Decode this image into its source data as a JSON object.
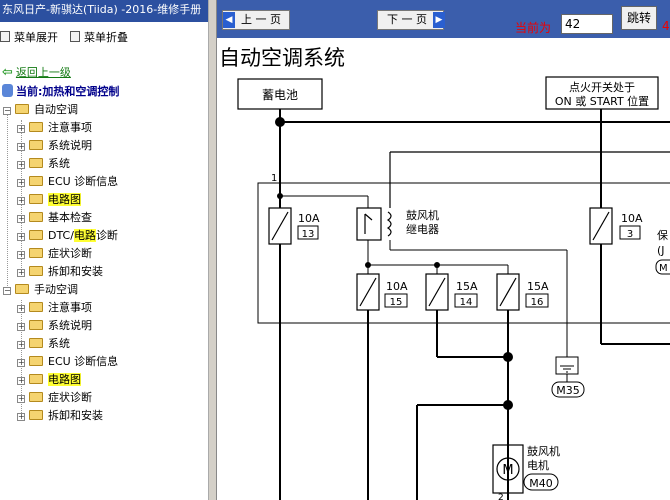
{
  "window": {
    "title": "东风日产-新骐达(Tiida) -2016-维修手册"
  },
  "menu": {
    "expand": "菜单展开",
    "collapse": "菜单折叠"
  },
  "nav": {
    "back": "返回上一级",
    "current": "当前:加热和空调控制"
  },
  "tree": {
    "auto_group": "自动空调",
    "manual_group": "手动空调",
    "auto_items": [
      "注意事项",
      "系统说明",
      "系统",
      "ECU 诊断信息",
      "电路图",
      "基本检查",
      "DTC/电路诊断",
      "症状诊断",
      "拆卸和安装"
    ],
    "manual_items": [
      "注意事项",
      "系统说明",
      "系统",
      "ECU 诊断信息",
      "电路图",
      "症状诊断",
      "拆卸和安装"
    ],
    "dtc_prefix": "DTC/",
    "dtc_highlight": "电路",
    "dtc_suffix": "诊断"
  },
  "toolbar": {
    "prev": "上 一 页",
    "next": "下 一 页",
    "page_label": "当前为",
    "page_value": "42",
    "jump": "跳转",
    "page_count_partial": "4"
  },
  "page": {
    "title": "自动空调系统"
  },
  "diagram": {
    "battery": "蓄电池",
    "ign_line1": "点火开关处于",
    "ign_line2": "ON 或 START 位置",
    "wire_1": "1",
    "wire_2": "2",
    "fuse_left_rating": "10A",
    "fuse_left_no": "13",
    "fuse_right_rating": "10A",
    "fuse_right_no": "3",
    "relay_line1": "鼓风机",
    "relay_line2": "继电器",
    "fuse_a_rating": "10A",
    "fuse_a_no": "15",
    "fuse_b_rating": "15A",
    "fuse_b_no": "14",
    "fuse_c_rating": "15A",
    "fuse_c_no": "16",
    "partial_1": "保",
    "partial_2": "(J",
    "partial_3": "M",
    "ground": "M35",
    "motor_line1": "鼓风机",
    "motor_line2": "电机",
    "motor_conn": "M40",
    "motor_symbol": "M"
  }
}
